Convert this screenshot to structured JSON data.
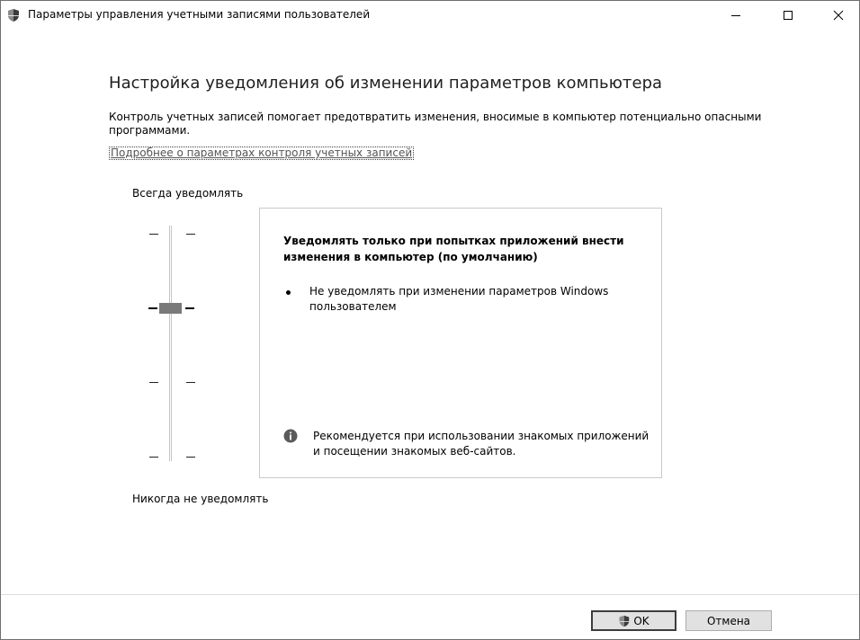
{
  "window": {
    "title": "Параметры управления учетными записями пользователей",
    "controls": {
      "minimize": "—",
      "maximize": "☐",
      "close": "✕"
    }
  },
  "main": {
    "heading": "Настройка уведомления об изменении параметров компьютера",
    "description": "Контроль учетных записей помогает предотвратить изменения, вносимые в компьютер потенциально опасными программами.",
    "more_link": "Подробнее о параметрах контроля учетных записей"
  },
  "slider": {
    "top_label": "Всегда уведомлять",
    "bottom_label": "Никогда не уведомлять",
    "levels": 4,
    "selected_level": 2
  },
  "info": {
    "title": "Уведомлять только при попытках приложений внести изменения в компьютер (по умолчанию)",
    "bullet": "Не уведомлять при изменении параметров Windows пользователем",
    "recommendation": "Рекомендуется при использовании знакомых приложений и посещении знакомых веб-сайтов."
  },
  "footer": {
    "ok_label": "OK",
    "cancel_label": "Отмена"
  },
  "icons": {
    "title_icon": "shield-icon",
    "ok_icon": "shield-icon",
    "info_icon": "info-icon"
  }
}
